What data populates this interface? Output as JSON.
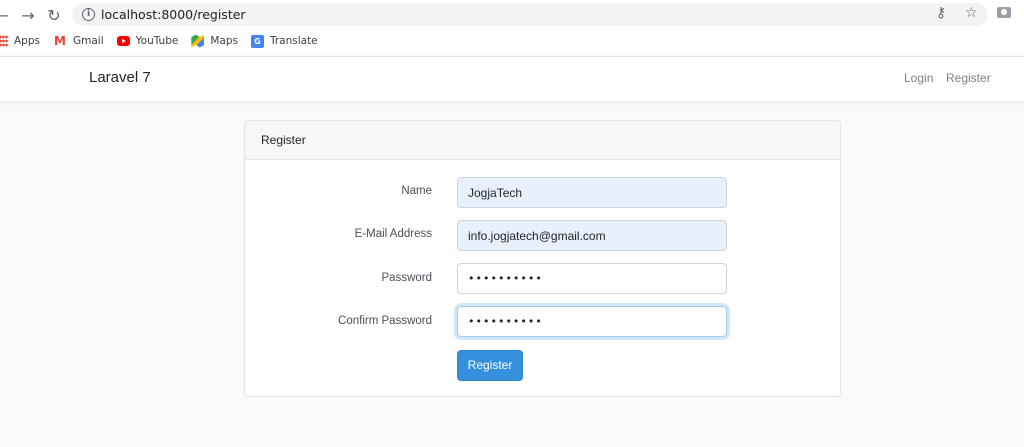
{
  "browser": {
    "url": "localhost:8000/register",
    "back_icon": "arrow-left-icon",
    "forward_icon": "arrow-right-icon",
    "reload_icon": "reload-icon",
    "bookmarks": [
      {
        "label": "Apps",
        "icon": "apps-grid-icon"
      },
      {
        "label": "Gmail",
        "icon": "gmail-icon"
      },
      {
        "label": "YouTube",
        "icon": "youtube-icon"
      },
      {
        "label": "Maps",
        "icon": "maps-icon"
      },
      {
        "label": "Translate",
        "icon": "translate-icon"
      }
    ]
  },
  "navbar": {
    "brand": "Laravel 7",
    "links": [
      {
        "label": "Login"
      },
      {
        "label": "Register"
      }
    ]
  },
  "card": {
    "header": "Register",
    "fields": [
      {
        "label": "Name",
        "value": "JogjaTech",
        "type": "text"
      },
      {
        "label": "E-Mail Address",
        "value": "info.jogjatech@gmail.com",
        "type": "email"
      },
      {
        "label": "Password",
        "value": "••••••••••",
        "type": "password"
      },
      {
        "label": "Confirm Password",
        "value": "••••••••••",
        "type": "password"
      }
    ],
    "submit_label": "Register"
  },
  "colors": {
    "primary": "#3490dc",
    "autofill": "#e8f0fe",
    "page_bg": "#f8fafc"
  }
}
